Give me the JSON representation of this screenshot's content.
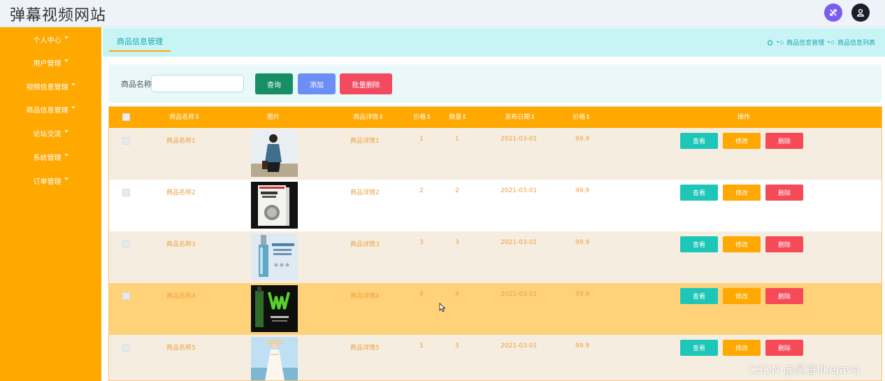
{
  "app": {
    "title": "弹幕视频网站"
  },
  "header": {
    "expand_icon": "shuffle-expand-icon",
    "user_icon": "user-icon",
    "accent": "#7b5cf0"
  },
  "sidebar": {
    "color": "#ffa800",
    "items": [
      {
        "label": "个人中心"
      },
      {
        "label": "用户管理"
      },
      {
        "label": "视频信息管理"
      },
      {
        "label": "商品信息管理"
      },
      {
        "label": "论坛交流"
      },
      {
        "label": "系统管理"
      },
      {
        "label": "订单管理"
      }
    ]
  },
  "tabs": {
    "active": "商品信息管理"
  },
  "breadcrumb": {
    "home_icon": "home-icon",
    "items": [
      "商品信息管理",
      "商品信息列表"
    ]
  },
  "search": {
    "label": "商品名称",
    "value": "",
    "placeholder": "",
    "query_label": "查询",
    "add_label": "添加",
    "batch_delete_label": "批量删除"
  },
  "table": {
    "headers": {
      "name": "商品名称",
      "image": "图片",
      "detail": "商品详情",
      "price": "价格",
      "quantity": "数量",
      "date": "发布日期",
      "price2": "价格",
      "ops": "操作"
    },
    "rows": [
      {
        "name": "商品名称1",
        "detail": "商品详情1",
        "price": "1",
        "quantity": "1",
        "date": "2021-03-01",
        "price2": "99.9",
        "bg": "#f6ede1",
        "image": "person-photo"
      },
      {
        "name": "商品名称2",
        "detail": "商品详情2",
        "price": "2",
        "quantity": "2",
        "date": "2021-03-01",
        "price2": "99.9",
        "bg": "#ffffff",
        "image": "book-cover"
      },
      {
        "name": "商品名称3",
        "detail": "商品详情3",
        "price": "3",
        "quantity": "3",
        "date": "2021-03-01",
        "price2": "99.9",
        "bg": "#f6ede1",
        "image": "lotion-bottle"
      },
      {
        "name": "商品名称4",
        "detail": "商品详情4",
        "price": "4",
        "quantity": "4",
        "date": "2021-03-01",
        "price2": "99.9",
        "bg": "#ffd27a",
        "image": "energy-drink"
      },
      {
        "name": "商品名称5",
        "detail": "商品详情5",
        "price": "5",
        "quantity": "5",
        "date": "2021-03-01",
        "price2": "99.9",
        "bg": "#f6ede1",
        "image": "dress-photo"
      }
    ],
    "ops": {
      "view": "查看",
      "edit": "修改",
      "delete": "删除"
    }
  },
  "watermark": "CSDN @昊言likeJava"
}
